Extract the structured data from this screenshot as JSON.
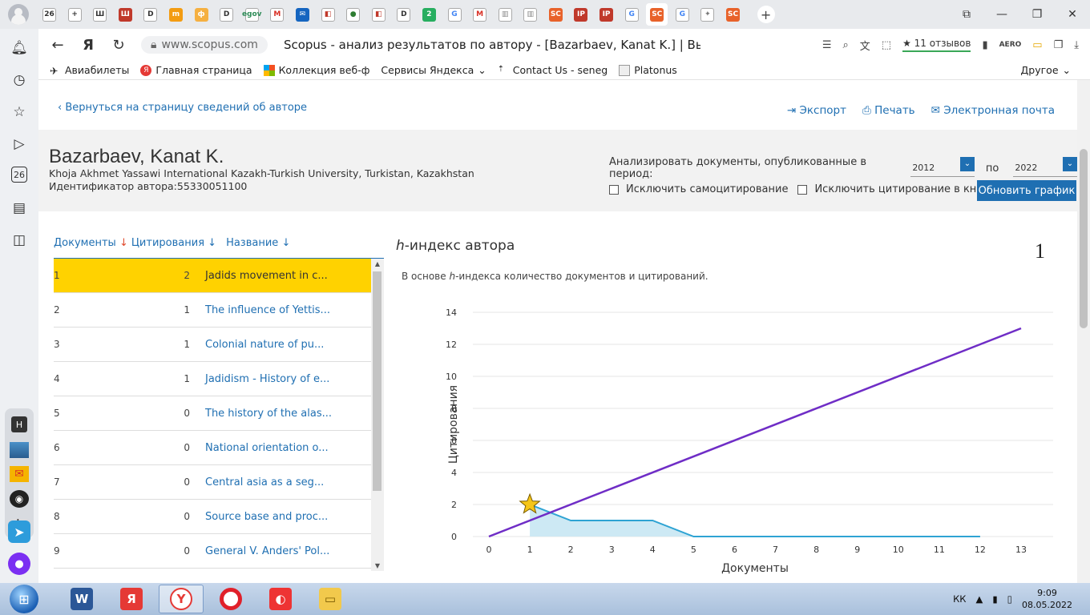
{
  "browser": {
    "url": "www.scopus.com",
    "page_title": "Scopus - анализ результатов по автору - [Bazarbaev, Kanat K.] | Вы...",
    "reviews": "11 отзывов",
    "tabs": [
      {
        "icon": "26",
        "bg": "#ffffff",
        "fg": "#333333"
      },
      {
        "icon": "+",
        "bg": "#ffffff",
        "fg": "#333333"
      },
      {
        "icon": "Ш",
        "bg": "#ffffff",
        "fg": "#333333"
      },
      {
        "icon": "Ш",
        "bg": "#c0392b",
        "fg": "#ffffff"
      },
      {
        "icon": "D",
        "bg": "#ffffff",
        "fg": "#333333"
      },
      {
        "icon": "m",
        "bg": "#f39c12",
        "fg": "#ffffff"
      },
      {
        "icon": "ф",
        "bg": "#f5b041",
        "fg": "#ffffff"
      },
      {
        "icon": "D",
        "bg": "#ffffff",
        "fg": "#333333"
      },
      {
        "icon": "egov",
        "bg": "#ffffff",
        "fg": "#2e8b57"
      },
      {
        "icon": "M",
        "bg": "#ffffff",
        "fg": "#d93025"
      },
      {
        "icon": "✉",
        "bg": "#1565c0",
        "fg": "#ffffff"
      },
      {
        "icon": "◧",
        "bg": "#ffffff",
        "fg": "#c0392b"
      },
      {
        "icon": "●",
        "bg": "#ffffff",
        "fg": "#2e7d32"
      },
      {
        "icon": "◧",
        "bg": "#ffffff",
        "fg": "#c0392b"
      },
      {
        "icon": "D",
        "bg": "#ffffff",
        "fg": "#333333"
      },
      {
        "icon": "2",
        "bg": "#27ae60",
        "fg": "#ffffff"
      },
      {
        "icon": "G",
        "bg": "#ffffff",
        "fg": "#4285f4"
      },
      {
        "icon": "M",
        "bg": "#ffffff",
        "fg": "#d93025"
      },
      {
        "icon": "▥",
        "bg": "#ffffff",
        "fg": "#888888"
      },
      {
        "icon": "▥",
        "bg": "#ffffff",
        "fg": "#888888"
      },
      {
        "icon": "SC",
        "bg": "#e8622a",
        "fg": "#ffffff"
      },
      {
        "icon": "IP",
        "bg": "#c0392b",
        "fg": "#ffffff"
      },
      {
        "icon": "IP",
        "bg": "#c0392b",
        "fg": "#ffffff"
      },
      {
        "icon": "G",
        "bg": "#ffffff",
        "fg": "#4285f4"
      },
      {
        "icon": "SC",
        "bg": "#e8622a",
        "fg": "#ffffff"
      },
      {
        "icon": "G",
        "bg": "#ffffff",
        "fg": "#4285f4"
      },
      {
        "icon": "✦",
        "bg": "#ffffff",
        "fg": "#777777"
      },
      {
        "icon": "SC",
        "bg": "#e8622a",
        "fg": "#ffffff"
      }
    ]
  },
  "bookmarks": {
    "items": [
      "Авиабилеты",
      "Главная страница",
      "Коллекция веб-ф",
      "Сервисы Яндекса",
      "Contact Us - seneg",
      "Platonus"
    ],
    "other": "Другое"
  },
  "page": {
    "back_link": "Вернуться на страницу сведений об авторе",
    "actions": {
      "export": "Экспорт",
      "print": "Печать",
      "email": "Электронная почта"
    }
  },
  "author": {
    "name": "Bazarbaev, Kanat K.",
    "affiliation": "Khoja Akhmet Yassawi International Kazakh-Turkish University, Turkistan, Kazakhstan",
    "id_line": "Идентификатор автора:55330051100"
  },
  "filters": {
    "period_label": "Анализировать документы, опубликованные в период:",
    "from": "2012",
    "to_label": "по",
    "to": "2022",
    "exclude_self": "Исключить самоцитирование",
    "exclude_books": "Исключить цитирование в книгах",
    "update_button": "Обновить график"
  },
  "table": {
    "col_docs": "Документы",
    "col_cites": "Цитирования",
    "col_title": "Название",
    "rows": [
      {
        "n": "1",
        "c": "2",
        "t": "Jadids movement in c..."
      },
      {
        "n": "2",
        "c": "1",
        "t": "The influence of Yettis..."
      },
      {
        "n": "3",
        "c": "1",
        "t": "Colonial nature of pu..."
      },
      {
        "n": "4",
        "c": "1",
        "t": "Jadidism - History of e..."
      },
      {
        "n": "5",
        "c": "0",
        "t": "The history of the alas..."
      },
      {
        "n": "6",
        "c": "0",
        "t": "National orientation o..."
      },
      {
        "n": "7",
        "c": "0",
        "t": "Central asia as a seg..."
      },
      {
        "n": "8",
        "c": "0",
        "t": "Source base and proc..."
      },
      {
        "n": "9",
        "c": "0",
        "t": "General V. Anders' Pol..."
      }
    ]
  },
  "hindex": {
    "title_h": "h",
    "title_rest": "-индекс автора",
    "value": "1",
    "subtitle_pre": "В основе ",
    "subtitle_h": "h",
    "subtitle_post": "-индекса количество документов и цитирований."
  },
  "chart_data": {
    "type": "line",
    "xlabel": "Документы",
    "ylabel": "Цитирования",
    "xlim": [
      0,
      13
    ],
    "ylim": [
      0,
      14
    ],
    "x_ticks": [
      0,
      1,
      2,
      3,
      4,
      5,
      6,
      7,
      8,
      9,
      10,
      11,
      12,
      13
    ],
    "y_ticks": [
      0,
      2,
      4,
      6,
      8,
      10,
      12,
      14
    ],
    "grid": true,
    "series": [
      {
        "x": [
          1,
          2,
          3,
          4,
          5,
          6,
          7,
          8,
          9,
          10,
          11,
          12
        ],
        "values": [
          2,
          1,
          1,
          1,
          0,
          0,
          0,
          0,
          0,
          0,
          0,
          0
        ],
        "color": "#2ea3d3",
        "fill": "#cde9f4"
      },
      {
        "x": [
          0,
          13
        ],
        "values": [
          0,
          13
        ],
        "color": "#6f2dc6"
      }
    ],
    "marker": {
      "x": 1,
      "y": 2,
      "shape": "star",
      "color": "#f5c518"
    }
  },
  "taskbar": {
    "lang": "КК",
    "time": "9:09",
    "date": "08.05.2022"
  }
}
